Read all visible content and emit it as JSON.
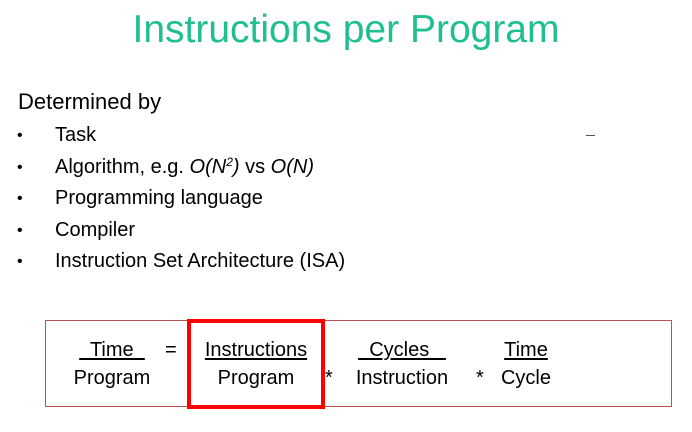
{
  "slide": {
    "title": "Instructions per Program",
    "title_color": "#1fbf8f",
    "subtitle": "Determined by",
    "bullet_glyph": "•",
    "bullets": [
      {
        "text": "Task"
      },
      {
        "prefix": "Algorithm, e.g. ",
        "big_o_left": "O(N",
        "superscript": "2",
        "big_o_right": ")",
        "middle": " vs ",
        "big_o_n": "O(N)"
      },
      {
        "text": "Programming language"
      },
      {
        "text": "Compiler"
      },
      {
        "text": "Instruction Set Architecture (ISA)"
      }
    ]
  },
  "formula": {
    "box_color": "#c0504d",
    "highlight_color": "#ff0000",
    "terms": [
      {
        "numerator": "  Time  ",
        "denominator": "Program"
      },
      {
        "numerator": "Instructions",
        "denominator": "Program"
      },
      {
        "numerator": "  Cycles   ",
        "denominator": "Instruction"
      },
      {
        "numerator": "Time",
        "denominator": "Cycle"
      }
    ],
    "equals": "=",
    "multiply": "*"
  }
}
